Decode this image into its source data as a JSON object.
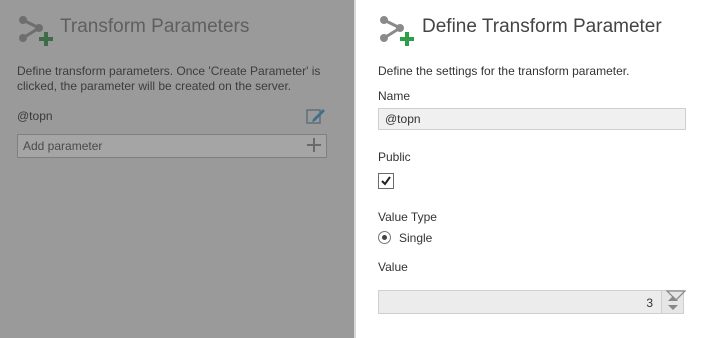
{
  "left_panel": {
    "title": "Transform Parameters",
    "description": "Define transform parameters. Once 'Create Parameter' is clicked, the parameter will be created on the server.",
    "parameters": [
      {
        "name": "@topn"
      }
    ],
    "add_parameter_label": "Add parameter",
    "icon": "transform-parameter-icon"
  },
  "right_panel": {
    "title": "Define Transform Parameter",
    "description": "Define the settings for the transform parameter.",
    "name_label": "Name",
    "name_value": "@topn",
    "public_label": "Public",
    "public_checked": true,
    "value_type_label": "Value Type",
    "value_type_option": "Single",
    "value_label": "Value",
    "value": "3",
    "icon": "transform-parameter-icon"
  },
  "colors": {
    "accent_green": "#2e9e4a",
    "icon_gray": "#8a8a8a"
  }
}
